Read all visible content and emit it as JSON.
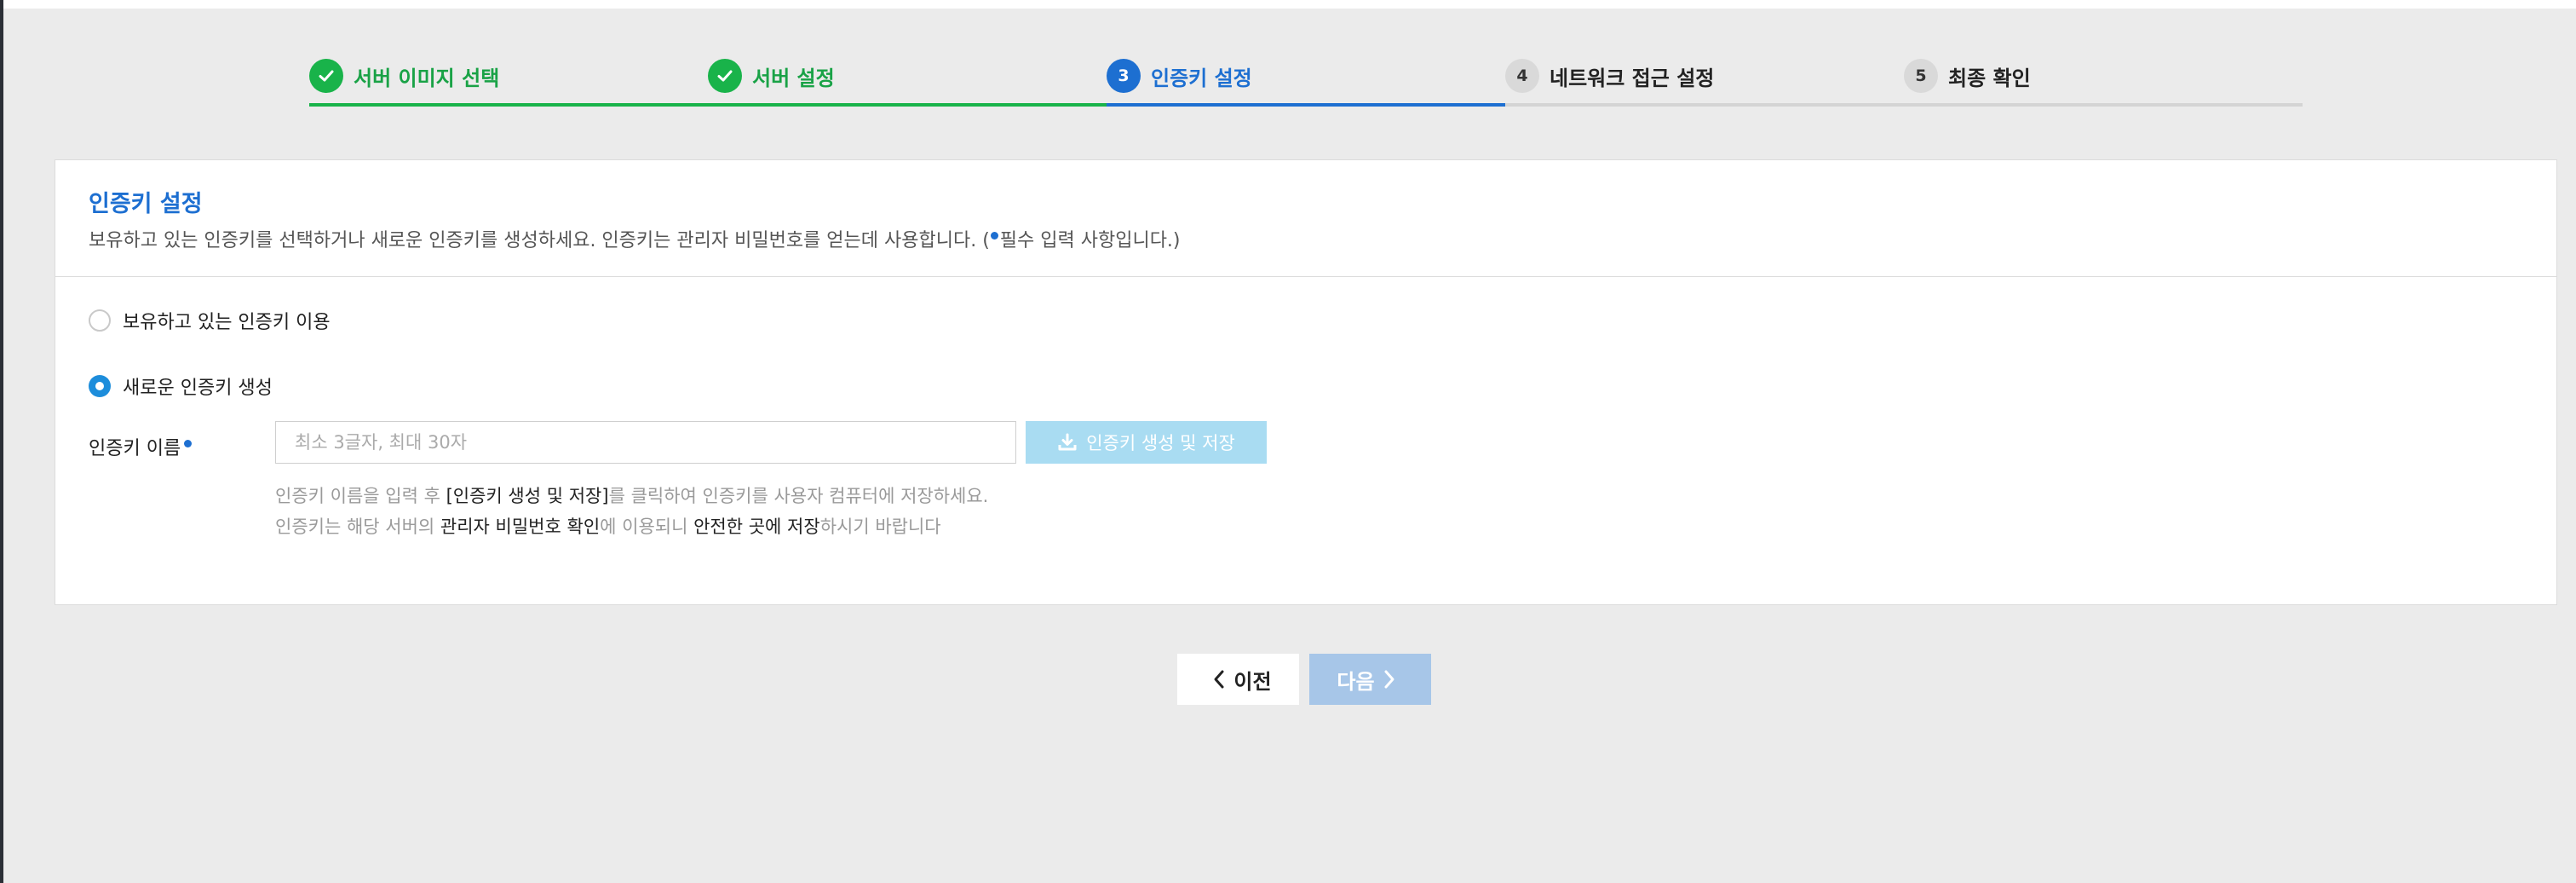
{
  "stepper": {
    "steps": [
      {
        "number": "1",
        "label": "서버 이미지 선택",
        "state": "done"
      },
      {
        "number": "2",
        "label": "서버 설정",
        "state": "done"
      },
      {
        "number": "3",
        "label": "인증키 설정",
        "state": "active"
      },
      {
        "number": "4",
        "label": "네트워크 접근 설정",
        "state": "pending"
      },
      {
        "number": "5",
        "label": "최종 확인",
        "state": "pending"
      }
    ]
  },
  "panel": {
    "title": "인증키 설정",
    "description_prefix": "보유하고 있는 인증키를 선택하거나 새로운 인증키를 생성하세요. 인증키는 관리자 비밀번호를 얻는데 사용합니다. (",
    "description_suffix": "필수 입력 사항입니다.)",
    "options": {
      "existing_label": "보유하고 있는 인증키 이용",
      "new_label": "새로운 인증키 생성",
      "selected": "new"
    },
    "key_name": {
      "label": "인증키 이름",
      "value": "",
      "placeholder": "최소 3글자, 최대 30자"
    },
    "generate_button_label": "인증키 생성 및 저장",
    "help": {
      "line1_a": "인증키 이름을 입력 후 ",
      "line1_b": "[인증키 생성 및 저장]",
      "line1_c": "를 클릭하여 인증키를 사용자 컴퓨터에 저장하세요.",
      "line2_a": "인증키는 해당 서버의 ",
      "line2_b": "관리자 비밀번호 확인",
      "line2_c": "에 이용되니 ",
      "line2_d": "안전한 곳에 저장",
      "line2_e": "하시기 바랍니다"
    }
  },
  "footer": {
    "prev_label": "이전",
    "next_label": "다음"
  },
  "colors": {
    "accent": "#1d6fd1",
    "done_green": "#19b34a",
    "generate_button_bg": "#a9dcf2",
    "next_button_bg": "#a7c6e8",
    "page_bg": "#ebebeb"
  }
}
